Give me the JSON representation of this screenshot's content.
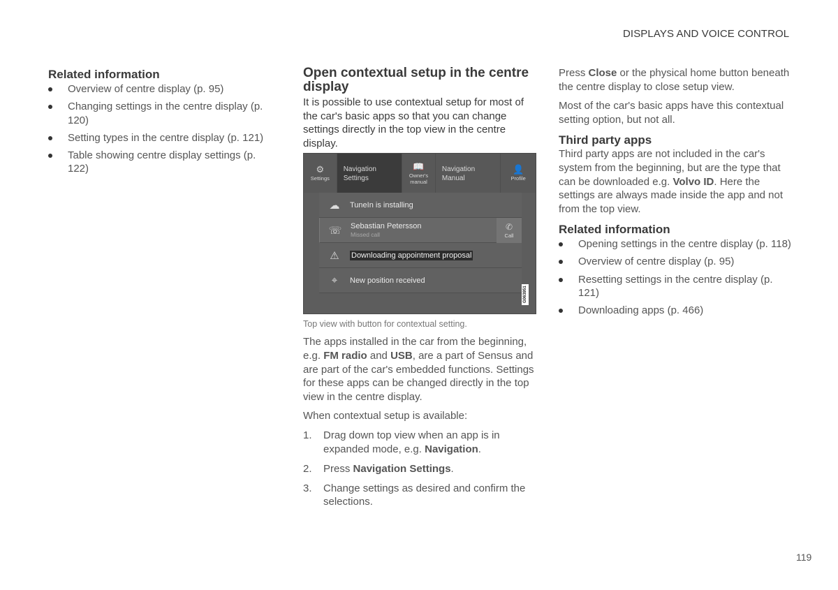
{
  "header": {
    "running_head": "DISPLAYS AND VOICE CONTROL"
  },
  "footer": {
    "page_number": "119"
  },
  "left_column": {
    "related_title": "Related information",
    "related_items": [
      "Overview of centre display (p. 95)",
      "Changing settings in the centre display (p. 120)",
      "Setting types in the centre display (p. 121)",
      "Table showing centre display settings (p. 122)"
    ]
  },
  "middle_column": {
    "title": "Open contextual setup in the centre display",
    "intro": "It is possible to use contextual setup for most of the car's basic apps so that you can change settings directly in the top view in the centre display.",
    "figure": {
      "topbar": {
        "settings_label": "Settings",
        "nav_settings_line1": "Navigation",
        "nav_settings_line2": "Settings",
        "owners_manual_line1": "Owner's",
        "owners_manual_line2": "manual",
        "nav_manual_line1": "Navigation",
        "nav_manual_line2": "Manual",
        "profile_label": "Profile"
      },
      "notifications": [
        {
          "icon": "cloud-download-icon",
          "text": "TuneIn is installing"
        },
        {
          "icon": "missed-call-icon",
          "text": "Sebastian Petersson",
          "subtext": "Missed call",
          "action": "Call"
        },
        {
          "icon": "warning-icon",
          "text": "Downloading appointment proposal"
        },
        {
          "icon": "position-icon",
          "text": "New position received"
        }
      ],
      "code": "G063951"
    },
    "caption": "Top view with button for contextual setting.",
    "para2_pre": "The apps installed in the car from the beginning, e.g. ",
    "para2_b1": "FM radio",
    "para2_mid": " and ",
    "para2_b2": "USB",
    "para2_post": ", are a part of Sensus and are part of the car's embedded functions. Settings for these apps can be changed directly in the top view in the centre display.",
    "para3": "When contextual setup is available:",
    "steps": [
      {
        "num": "1.",
        "pre": "Drag down top view when an app is in expanded mode, e.g. ",
        "bold": "Navigation",
        "post": "."
      },
      {
        "num": "2.",
        "pre": "Press ",
        "bold": "Navigation Settings",
        "post": "."
      },
      {
        "num": "3.",
        "pre": "Change settings as desired and confirm the selections.",
        "bold": "",
        "post": ""
      }
    ]
  },
  "right_column": {
    "p1_pre": "Press ",
    "p1_bold": "Close",
    "p1_post": " or the physical home button beneath the centre display to close setup view.",
    "p2": "Most of the car's basic apps have this contextual setting option, but not all.",
    "third_party_title": "Third party apps",
    "p3_pre": "Third party apps are not included in the car's system from the beginning, but are the type that can be downloaded e.g. ",
    "p3_bold": "Volvo ID",
    "p3_post": ". Here the settings are always made inside the app and not from the top view.",
    "related_title": "Related information",
    "related_items": [
      "Opening settings in the centre display (p. 118)",
      "Overview of centre display (p. 95)",
      "Resetting settings in the centre display (p. 121)",
      "Downloading apps (p. 466)"
    ]
  }
}
